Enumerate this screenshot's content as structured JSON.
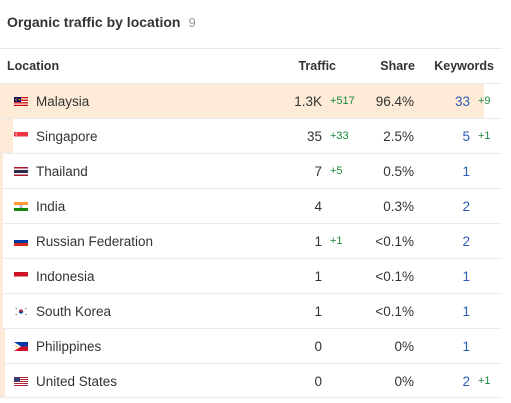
{
  "header": {
    "title": "Organic traffic by location",
    "count": "9"
  },
  "columns": {
    "location": "Location",
    "traffic": "Traffic",
    "share": "Share",
    "keywords": "Keywords"
  },
  "rows": [
    {
      "flag_icon": "malaysia-flag-icon",
      "location": "Malaysia",
      "traffic": "1.3K",
      "traffic_delta": "+517",
      "share": "96.4%",
      "share_value": 96.4,
      "keywords": "33",
      "keywords_delta": "+9",
      "highlight": true
    },
    {
      "flag_icon": "singapore-flag-icon",
      "location": "Singapore",
      "traffic": "35",
      "traffic_delta": "+33",
      "share": "2.5%",
      "share_value": 2.5,
      "keywords": "5",
      "keywords_delta": "+1"
    },
    {
      "flag_icon": "thailand-flag-icon",
      "location": "Thailand",
      "traffic": "7",
      "traffic_delta": "+5",
      "share": "0.5%",
      "share_value": 0.5,
      "keywords": "1",
      "keywords_delta": ""
    },
    {
      "flag_icon": "india-flag-icon",
      "location": "India",
      "traffic": "4",
      "traffic_delta": "",
      "share": "0.3%",
      "share_value": 0.3,
      "keywords": "2",
      "keywords_delta": ""
    },
    {
      "flag_icon": "russia-flag-icon",
      "location": "Russian Federation",
      "traffic": "1",
      "traffic_delta": "+1",
      "share": "<0.1%",
      "share_value": 0.05,
      "keywords": "2",
      "keywords_delta": ""
    },
    {
      "flag_icon": "indonesia-flag-icon",
      "location": "Indonesia",
      "traffic": "1",
      "traffic_delta": "",
      "share": "<0.1%",
      "share_value": 0.05,
      "keywords": "1",
      "keywords_delta": ""
    },
    {
      "flag_icon": "south-korea-flag-icon",
      "location": "South Korea",
      "traffic": "1",
      "traffic_delta": "",
      "share": "<0.1%",
      "share_value": 0.05,
      "keywords": "1",
      "keywords_delta": ""
    },
    {
      "flag_icon": "philippines-flag-icon",
      "location": "Philippines",
      "traffic": "0",
      "traffic_delta": "",
      "share": "0%",
      "share_value": 0,
      "keywords": "1",
      "keywords_delta": ""
    },
    {
      "flag_icon": "united-states-flag-icon",
      "location": "United States",
      "traffic": "0",
      "traffic_delta": "",
      "share": "0%",
      "share_value": 0,
      "keywords": "2",
      "keywords_delta": "+1"
    }
  ],
  "colors": {
    "share_bar": "#fdebd7",
    "delta_positive": "#1a8a3a",
    "keyword_link": "#2b5cb8"
  }
}
